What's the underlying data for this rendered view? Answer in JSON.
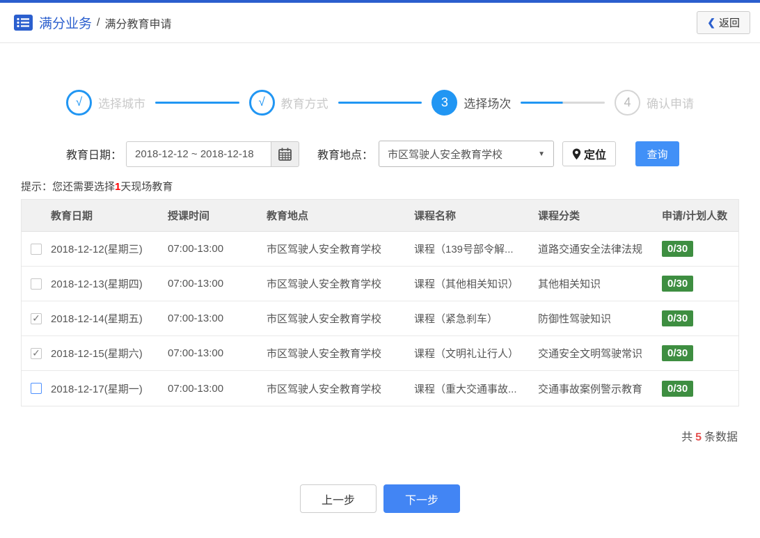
{
  "header": {
    "breadcrumb_primary": "满分业务",
    "breadcrumb_separator": "/",
    "breadcrumb_secondary": "满分教育申请",
    "back_chevron": "❮",
    "back_label": "返回"
  },
  "steps": [
    {
      "symbol": "√",
      "label": "选择城市",
      "state": "done"
    },
    {
      "symbol": "√",
      "label": "教育方式",
      "state": "done"
    },
    {
      "symbol": "3",
      "label": "选择场次",
      "state": "active"
    },
    {
      "symbol": "4",
      "label": "确认申请",
      "state": "pending"
    }
  ],
  "filters": {
    "date_label": "教育日期：",
    "date_value": "2018-12-12 ~ 2018-12-18",
    "location_label": "教育地点：",
    "location_value": "市区驾驶人安全教育学校",
    "dropdown_arrow": "▼",
    "locate_label": "定位",
    "query_label": "查询"
  },
  "hint": {
    "prefix": "提示：您还需要选择",
    "highlight": "1",
    "suffix": "天现场教育"
  },
  "table": {
    "headers": [
      "教育日期",
      "授课时间",
      "教育地点",
      "课程名称",
      "课程分类",
      "申请/计划人数"
    ],
    "check_glyph": "✓",
    "rows": [
      {
        "checkbox": "unchecked",
        "date": "2018-12-12(星期三)",
        "time": "07:00-13:00",
        "place": "市区驾驶人安全教育学校",
        "course": "课程（139号部令解...",
        "category": "道路交通安全法律法规",
        "count": "0/30"
      },
      {
        "checkbox": "unchecked",
        "date": "2018-12-13(星期四)",
        "time": "07:00-13:00",
        "place": "市区驾驶人安全教育学校",
        "course": "课程（其他相关知识）",
        "category": "其他相关知识",
        "count": "0/30"
      },
      {
        "checkbox": "checked",
        "date": "2018-12-14(星期五)",
        "time": "07:00-13:00",
        "place": "市区驾驶人安全教育学校",
        "course": "课程（紧急刹车）",
        "category": "防御性驾驶知识",
        "count": "0/30"
      },
      {
        "checkbox": "checked",
        "date": "2018-12-15(星期六)",
        "time": "07:00-13:00",
        "place": "市区驾驶人安全教育学校",
        "course": "课程（文明礼让行人）",
        "category": "交通安全文明驾驶常识",
        "count": "0/30"
      },
      {
        "checkbox": "unchecked_active",
        "date": "2018-12-17(星期一)",
        "time": "07:00-13:00",
        "place": "市区驾驶人安全教育学校",
        "course": "课程（重大交通事故...",
        "category": "交通事故案例警示教育",
        "count": "0/30"
      }
    ]
  },
  "summary": {
    "prefix": "共",
    "count": "5",
    "suffix": "条数据"
  },
  "footer": {
    "prev_label": "上一步",
    "next_label": "下一步"
  },
  "colors": {
    "brand_blue": "#2b5fce",
    "step_blue": "#2196f3",
    "button_blue": "#4285f4",
    "badge_green": "#3e8e41",
    "hint_red": "#ff0000",
    "count_red": "#e6504f"
  }
}
